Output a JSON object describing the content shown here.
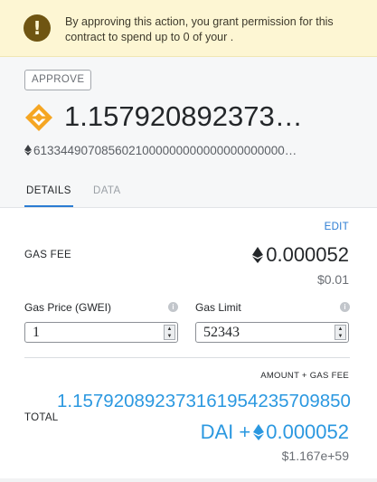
{
  "warning": {
    "icon": "exclamation-icon",
    "text": "By approving this action, you grant permission for this contract to spend up to 0 of your ."
  },
  "summary": {
    "action_chip": "APPROVE",
    "token_icon": "dai-token-icon",
    "amount": "1.157920892373…",
    "eth_value": "6133449070856021000000000000000000000…"
  },
  "tabs": [
    {
      "label": "DETAILS",
      "active": true
    },
    {
      "label": "DATA",
      "active": false
    }
  ],
  "details": {
    "edit_label": "EDIT",
    "gas_fee_label": "GAS FEE",
    "gas_fee_value": "0.000052",
    "gas_fee_usd": "$0.01",
    "gas_price_label": "Gas Price (GWEI)",
    "gas_price_value": "1",
    "gas_limit_label": "Gas Limit",
    "gas_limit_value": "52343",
    "amount_plus_gas_label": "AMOUNT + GAS FEE",
    "total_label": "TOTAL",
    "total_amount_line1": "1.157920892373161954235709850",
    "total_amount_line2_prefix": "DAI +",
    "total_gas_value": "0.000052",
    "total_usd": "$1.167e+59"
  },
  "colors": {
    "accent_blue": "#2b7cd3",
    "total_blue": "#2b98e0",
    "warning_bg": "#fdf6d3",
    "dai_orange": "#f5a623"
  }
}
